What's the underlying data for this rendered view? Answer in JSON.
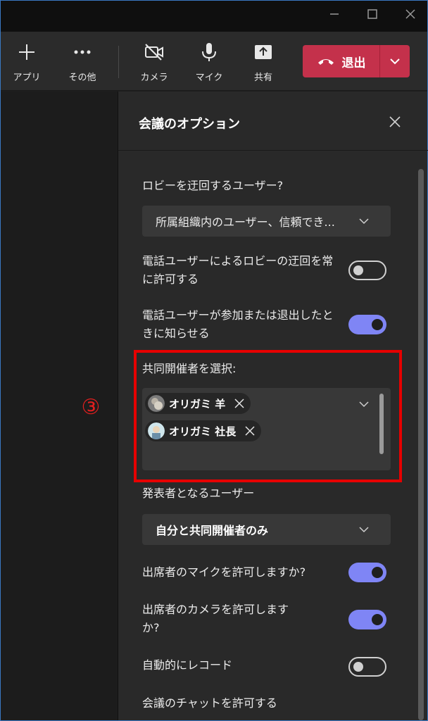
{
  "toolbar": {
    "apps_label": "アプリ",
    "more_label": "その他",
    "camera_label": "カメラ",
    "mic_label": "マイク",
    "share_label": "共有",
    "leave_label": "退出"
  },
  "annotation": {
    "marker": "③"
  },
  "panel": {
    "title": "会議のオプション",
    "bypass_lobby_label": "ロビーを迂回するユーザー?",
    "bypass_lobby_value": "所属組織内のユーザー、信頼でき...",
    "phone_bypass_label": "電話ユーザーによるロビーの迂回を常に許可する",
    "phone_bypass_on": false,
    "phone_notify_label": "電話ユーザーが参加または退出したときに知らせる",
    "phone_notify_on": true,
    "coorganizer_label": "共同開催者を選択:",
    "coorganizers": [
      "オリガミ 羊",
      "オリガミ 社長"
    ],
    "presenters_label": "発表者となるユーザー",
    "presenters_value": "自分と共同開催者のみ",
    "attendee_mic_label": "出席者のマイクを許可しますか?",
    "attendee_mic_on": true,
    "attendee_camera_label": "出席者のカメラを許可しますか?",
    "attendee_camera_on": true,
    "auto_record_label": "自動的にレコード",
    "auto_record_on": false,
    "chat_label": "会議のチャットを許可する"
  },
  "colors": {
    "toggle_on": "#7f85f5",
    "leave_button": "#c4314b",
    "annotation_red": "#e60000"
  }
}
